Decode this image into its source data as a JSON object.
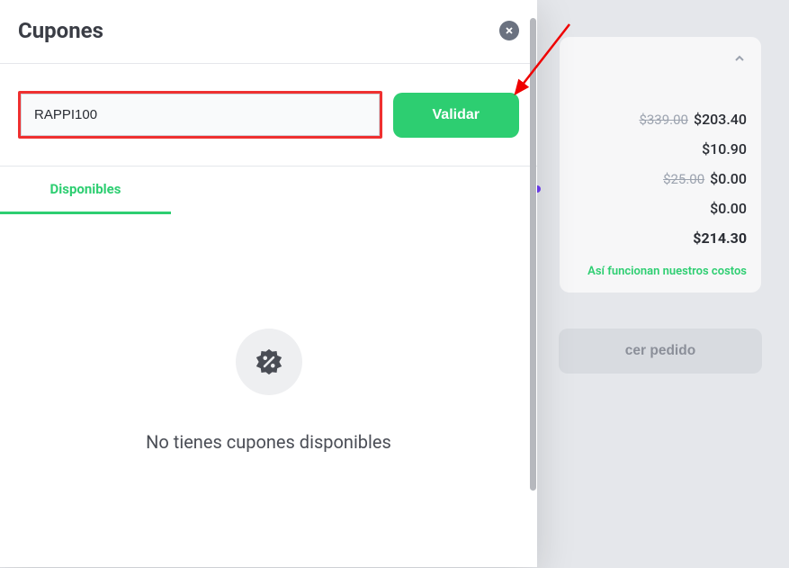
{
  "modal": {
    "title": "Cupones",
    "coupon_input_value": "RAPPI100",
    "validate_label": "Validar",
    "tab_available": "Disponibles",
    "empty_message": "No tienes cupones disponibles"
  },
  "order": {
    "rows": [
      {
        "old": "$339.00",
        "current": "$203.40"
      },
      {
        "old": "",
        "current": "$10.90"
      },
      {
        "old": "$25.00",
        "current": "$0.00"
      },
      {
        "old": "",
        "current": "$0.00"
      }
    ],
    "total": "$214.30",
    "costs_link": "Así funcionan nuestros costos",
    "order_button_partial": "cer pedido"
  },
  "colors": {
    "accent": "#2dce71",
    "highlight_red": "#ef3030"
  }
}
